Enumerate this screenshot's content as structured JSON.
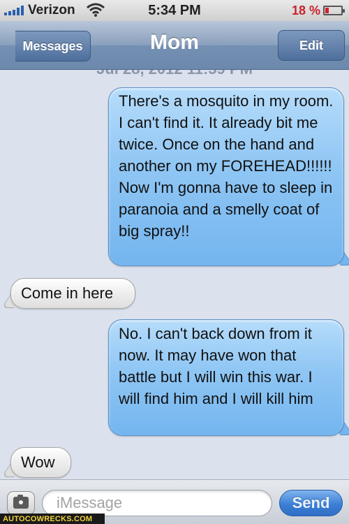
{
  "status_bar": {
    "carrier": "Verizon",
    "time": "5:34 PM",
    "battery_percent": "18 %",
    "battery_level": 0.18
  },
  "nav": {
    "back_label": "Messages",
    "title": "Mom",
    "edit_label": "Edit"
  },
  "conversation": {
    "timestamp": "Jul 28, 2012 11:59 PM",
    "messages": [
      {
        "sender": "me",
        "text": "There's a mosquito in my room. I can't find it. It already bit me twice. Once on the hand and another on my FOREHEAD!!!!!! Now I'm gonna have to sleep in paranoia and a smelly coat of big spray!!"
      },
      {
        "sender": "Mom",
        "text": "Come in here"
      },
      {
        "sender": "me",
        "text": "No. I can't back down from it now. It may have won that battle but I will win this war. I will find him and I will kill him"
      },
      {
        "sender": "Mom",
        "text": "Wow"
      }
    ]
  },
  "input_bar": {
    "placeholder": "iMessage",
    "send_label": "Send"
  },
  "watermark": "AUTOCOWRECKS.COM",
  "colors": {
    "sent_bubble": "#8fc6f4",
    "received_bubble": "#e8e8e8",
    "nav_bar": "#8aa0bc",
    "battery_low": "#c8232a",
    "send_button": "#3d7fd6"
  }
}
